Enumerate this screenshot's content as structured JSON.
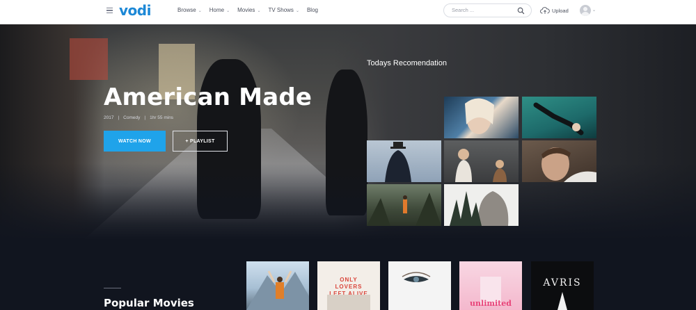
{
  "header": {
    "logo": "vodi",
    "nav": [
      {
        "label": "Browse",
        "has_dropdown": true
      },
      {
        "label": "Home",
        "has_dropdown": true
      },
      {
        "label": "Movies",
        "has_dropdown": true
      },
      {
        "label": "TV Shows",
        "has_dropdown": true
      },
      {
        "label": "Blog",
        "has_dropdown": false
      }
    ],
    "search_placeholder": "Search ...",
    "upload_label": "Upload",
    "icons": {
      "menu": "hamburger-icon",
      "search": "search-icon",
      "upload": "cloud-upload-icon",
      "avatar": "user-avatar-icon"
    }
  },
  "hero": {
    "title": "American Made",
    "year": "2017",
    "genre": "Comedy",
    "duration": "1hr 55 mins",
    "separator": "|",
    "watch_label": "WATCH NOW",
    "playlist_label": "+ PLAYLIST",
    "accent_color": "#1fa3ea"
  },
  "recommendation": {
    "title": "Todays Recomendation"
  },
  "popular": {
    "title": "Popular Movies",
    "posters": [
      {
        "text": ""
      },
      {
        "text": "ONLY LOVERS LEFT ALIVE"
      },
      {
        "text": ""
      },
      {
        "text": "unlimited"
      },
      {
        "text": "AVRIS"
      }
    ]
  }
}
